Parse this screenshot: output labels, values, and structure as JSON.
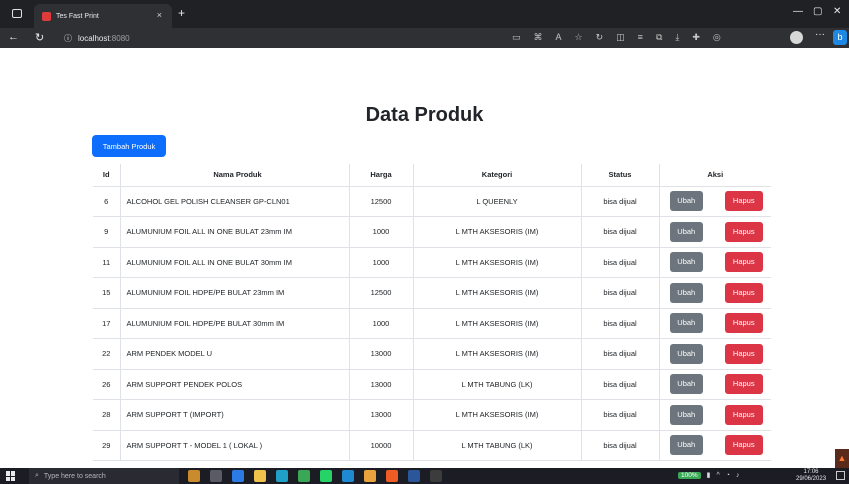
{
  "browser": {
    "tab_title": "Tes Fast Print",
    "tab_close": "×",
    "new_tab": "+",
    "url_host": "localhost",
    "url_port": ":8080",
    "back": "←",
    "reload": "↻",
    "info": "ⓘ",
    "more": "···",
    "minimize": "—",
    "restore": "▢",
    "close": "✕"
  },
  "page": {
    "title": "Data Produk",
    "add_button": "Tambah Produk"
  },
  "table": {
    "headers": [
      "Id",
      "Nama Produk",
      "Harga",
      "Kategori",
      "Status",
      "Aksi"
    ],
    "edit_label": "Ubah",
    "delete_label": "Hapus",
    "rows": [
      {
        "id": "6",
        "nama": "ALCOHOL GEL POLISH CLEANSER GP-CLN01",
        "harga": "12500",
        "kategori": "L QUEENLY",
        "status": "bisa dijual"
      },
      {
        "id": "9",
        "nama": "ALUMUNIUM FOIL ALL IN ONE BULAT 23mm IM",
        "harga": "1000",
        "kategori": "L MTH AKSESORIS (IM)",
        "status": "bisa dijual"
      },
      {
        "id": "11",
        "nama": "ALUMUNIUM FOIL ALL IN ONE BULAT 30mm IM",
        "harga": "1000",
        "kategori": "L MTH AKSESORIS (IM)",
        "status": "bisa dijual"
      },
      {
        "id": "15",
        "nama": "ALUMUNIUM FOIL HDPE/PE BULAT 23mm IM",
        "harga": "12500",
        "kategori": "L MTH AKSESORIS (IM)",
        "status": "bisa dijual"
      },
      {
        "id": "17",
        "nama": "ALUMUNIUM FOIL HDPE/PE BULAT 30mm IM",
        "harga": "1000",
        "kategori": "L MTH AKSESORIS (IM)",
        "status": "bisa dijual"
      },
      {
        "id": "22",
        "nama": "ARM PENDEK MODEL U",
        "harga": "13000",
        "kategori": "L MTH AKSESORIS (IM)",
        "status": "bisa dijual"
      },
      {
        "id": "26",
        "nama": "ARM SUPPORT PENDEK POLOS",
        "harga": "13000",
        "kategori": "L MTH TABUNG (LK)",
        "status": "bisa dijual"
      },
      {
        "id": "28",
        "nama": "ARM SUPPORT T (IMPORT)",
        "harga": "13000",
        "kategori": "L MTH AKSESORIS (IM)",
        "status": "bisa dijual"
      },
      {
        "id": "29",
        "nama": "ARM SUPPORT T - MODEL 1 ( LOKAL )",
        "harga": "10000",
        "kategori": "L MTH TABUNG (LK)",
        "status": "bisa dijual"
      }
    ]
  },
  "taskbar": {
    "search_placeholder": "Type here to search",
    "battery": "100%",
    "time": "17:06",
    "date": "29/06/2023"
  },
  "colors": {
    "primary": "#0d6efd",
    "secondary": "#6c757d",
    "danger": "#dc3545"
  }
}
